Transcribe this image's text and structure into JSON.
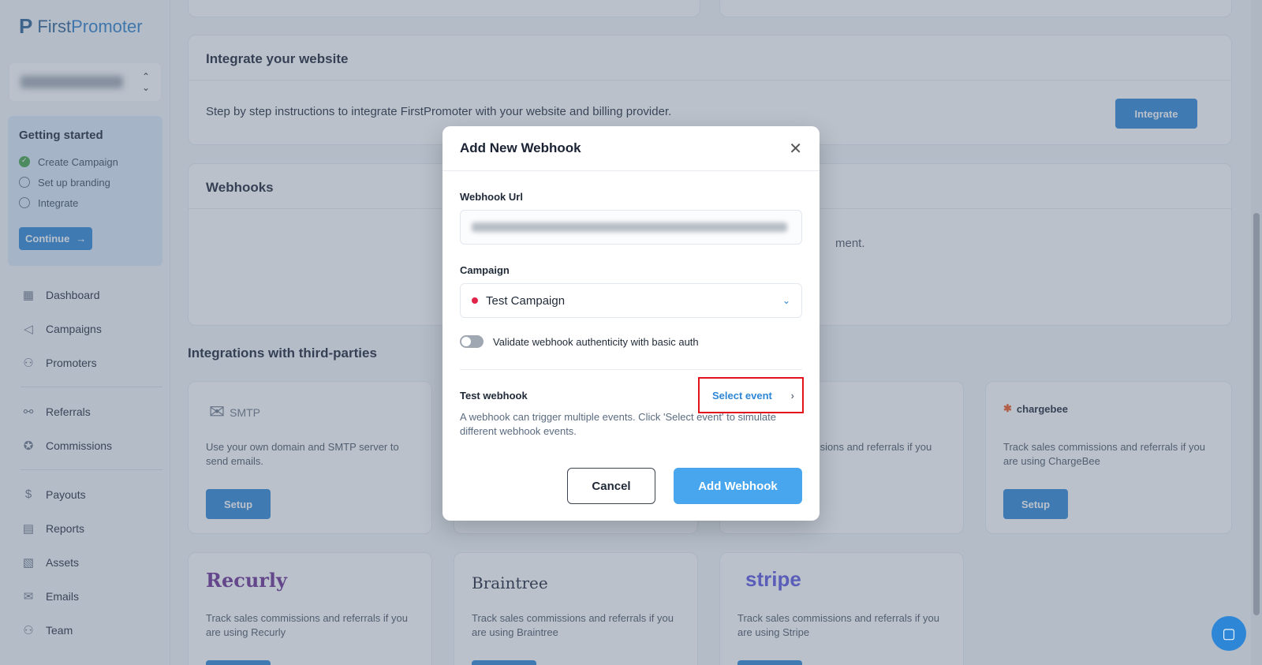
{
  "brand": {
    "logo_mark": "P",
    "logo_first": "First",
    "logo_promoter": "Promoter"
  },
  "getting_started": {
    "title": "Getting started",
    "items": [
      {
        "label": "Create Campaign",
        "done": true
      },
      {
        "label": "Set up branding",
        "done": false
      },
      {
        "label": "Integrate",
        "done": false
      }
    ],
    "continue_label": "Continue",
    "continue_icon": "arrow-right-icon"
  },
  "nav": [
    {
      "label": "Dashboard",
      "icon": "dashboard-icon",
      "glyph": "▦"
    },
    {
      "label": "Campaigns",
      "icon": "megaphone-icon",
      "glyph": "📢"
    },
    {
      "label": "Promoters",
      "icon": "users-icon",
      "glyph": "👥"
    },
    {
      "label": "Referrals",
      "icon": "referrals-icon",
      "glyph": "⚯"
    },
    {
      "label": "Commissions",
      "icon": "award-icon",
      "glyph": "✪"
    },
    {
      "label": "Payouts",
      "icon": "dollar-icon",
      "glyph": "$"
    },
    {
      "label": "Reports",
      "icon": "reports-icon",
      "glyph": "▤"
    },
    {
      "label": "Assets",
      "icon": "image-icon",
      "glyph": "▧"
    },
    {
      "label": "Emails",
      "icon": "mail-icon",
      "glyph": "✉"
    },
    {
      "label": "Team",
      "icon": "team-icon",
      "glyph": "⚇"
    }
  ],
  "integrate_card": {
    "title": "Integrate your website",
    "description": "Step by step instructions to integrate FirstPromoter with your website and billing provider.",
    "button": "Integrate"
  },
  "webhooks_card": {
    "title": "Webhooks",
    "partial_text": "ment."
  },
  "integrations": {
    "title": "Integrations with third-parties",
    "smtp": {
      "name": "SMTP",
      "description": "Use your own domain and SMTP server to send emails.",
      "button": "Setup"
    },
    "partial": {
      "description": "nissions and referrals if you"
    },
    "chargebee": {
      "name": "chargebee",
      "description": "Track sales commissions and referrals if you are using ChargeBee",
      "button": "Setup"
    },
    "recurly": {
      "name": "Recurly",
      "description": "Track sales commissions and referrals if you are using Recurly"
    },
    "braintree": {
      "name": "Braintree",
      "description": "Track sales commissions and referrals if you are using Braintree"
    },
    "stripe": {
      "name": "stripe",
      "description": "Track sales commissions and referrals if you are using Stripe"
    }
  },
  "modal": {
    "title": "Add New Webhook",
    "url_label": "Webhook Url",
    "campaign_label": "Campaign",
    "campaign_value": "Test Campaign",
    "toggle_label": "Validate webhook authenticity with basic auth",
    "toggle_on": false,
    "test_label": "Test webhook",
    "select_event": "Select event",
    "test_description": "A webhook can trigger multiple events. Click 'Select event' to simulate different webhook events.",
    "cancel": "Cancel",
    "add": "Add Webhook"
  },
  "colors": {
    "accent": "#2e86d6",
    "highlight": "#e3121b",
    "campaign_dot": "#e0244a"
  }
}
